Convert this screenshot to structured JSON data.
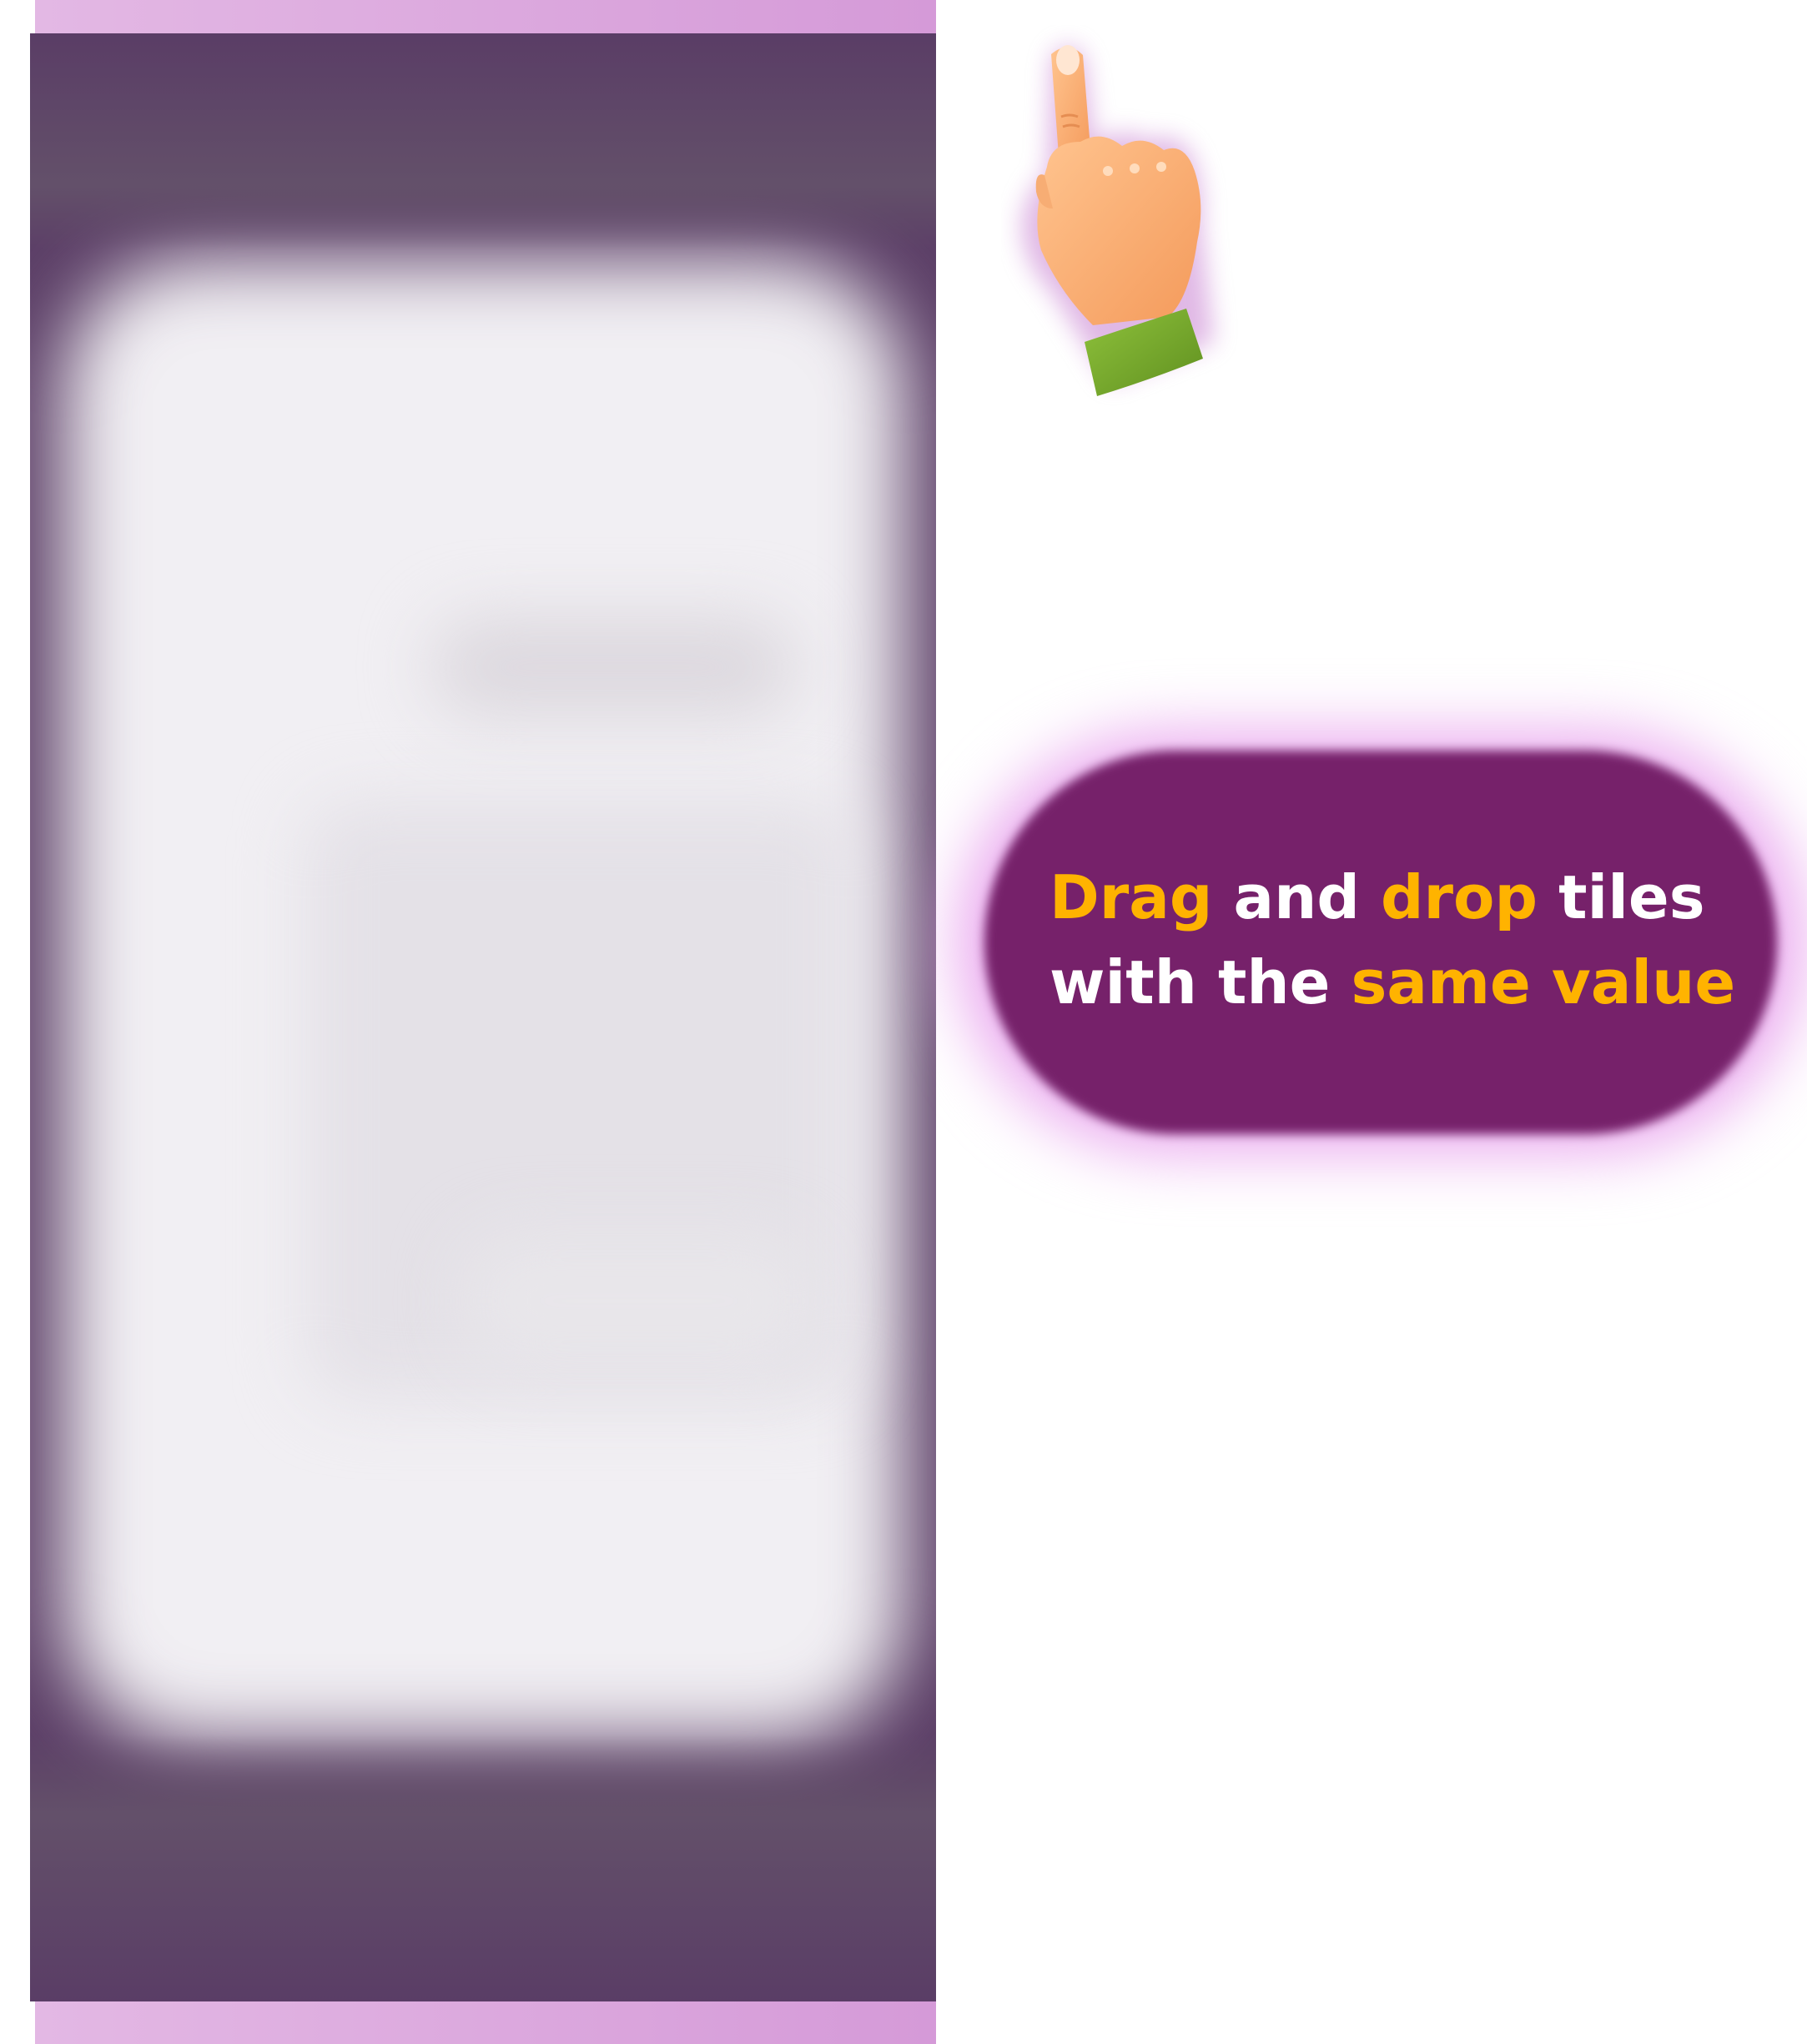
{
  "instruction": {
    "line1": {
      "word1": "Drag",
      "word2": "and",
      "word3": "drop",
      "word4": "tiles"
    },
    "line2": {
      "word1": "with the",
      "word2": "same value"
    }
  },
  "colors": {
    "highlight": "#ffb300",
    "text": "#ffffff",
    "bubble": "#76216a",
    "panel": "#5c3f67",
    "accent_bar": "#d59ad8"
  },
  "icons": {
    "pointer": "pointing-hand-icon"
  }
}
